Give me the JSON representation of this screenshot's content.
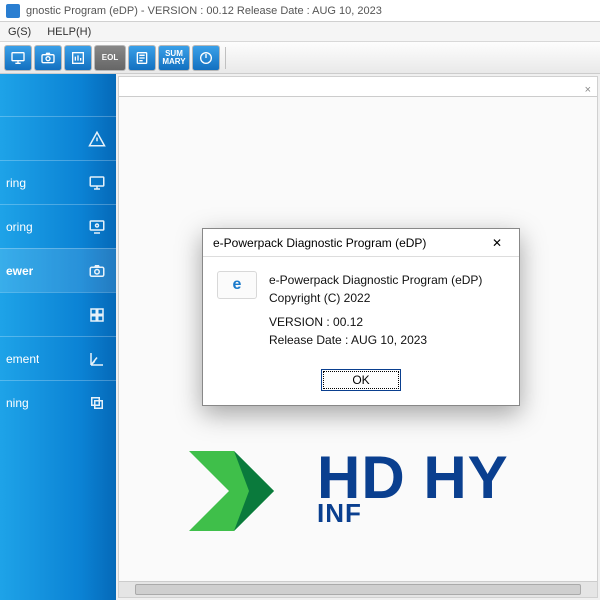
{
  "window": {
    "title": "gnostic Program (eDP) - VERSION : 00.12 Release Date : AUG 10, 2023"
  },
  "menubar": {
    "items": [
      "G(S)",
      "HELP(H)"
    ]
  },
  "toolbar": {
    "eol_label": "EOL",
    "sum_label": "SUM\nMARY"
  },
  "sidebar": {
    "items": [
      {
        "label": "",
        "icon": "power"
      },
      {
        "label": "",
        "icon": "warning"
      },
      {
        "label": "ring",
        "icon": "monitor"
      },
      {
        "label": "oring",
        "icon": "monitor-eye"
      },
      {
        "label": "ewer",
        "icon": "camera",
        "selected": true
      },
      {
        "label": "",
        "icon": "grid"
      },
      {
        "label": "ement",
        "icon": "axes"
      },
      {
        "label": "ning",
        "icon": "layer"
      }
    ]
  },
  "tabs": {
    "close_glyph": "×"
  },
  "logo": {
    "hd": "HD",
    "line1": "HY",
    "line2": "INF"
  },
  "dialog": {
    "title": "e-Powerpack Diagnostic Program (eDP)",
    "icon_text": "e",
    "product": "e-Powerpack Diagnostic Program (eDP)",
    "copyright": "Copyright (C) 2022",
    "version": "VERSION : 00.12",
    "release": "Release Date : AUG 10, 2023",
    "ok": "OK",
    "close_glyph": "✕"
  }
}
